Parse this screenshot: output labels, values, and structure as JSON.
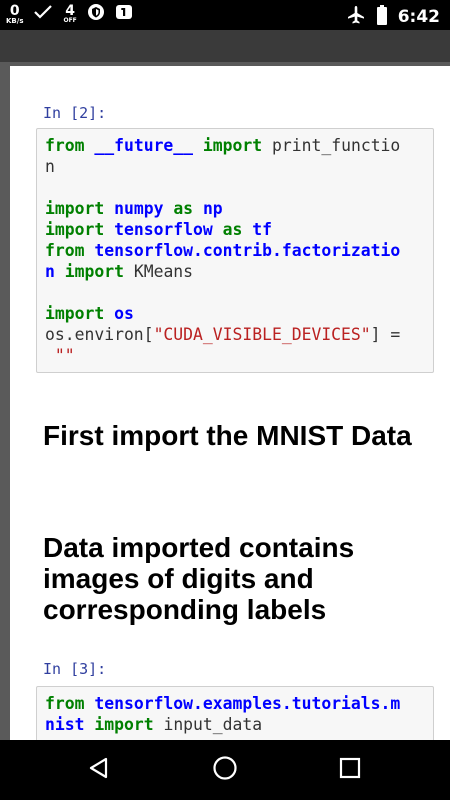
{
  "status_bar": {
    "net_speed_value": "0",
    "net_speed_unit": "KB/s",
    "network_type": "4",
    "network_sub": "OFF",
    "time": "6:42",
    "icons": [
      "check-icon",
      "vpn-shield-icon",
      "notification-badge-icon",
      "airplane-mode-icon",
      "battery-icon"
    ]
  },
  "notebook": {
    "cells": [
      {
        "prompt": "In [2]:",
        "lines": [
          [
            [
              "kw",
              "from"
            ],
            [
              "t",
              " "
            ],
            [
              "nm",
              "__future__"
            ],
            [
              "t",
              " "
            ],
            [
              "kw",
              "import"
            ],
            [
              "t",
              " print_functio"
            ]
          ],
          [
            [
              "t",
              "n"
            ]
          ],
          [
            [
              "t",
              ""
            ]
          ],
          [
            [
              "kw",
              "import"
            ],
            [
              "t",
              " "
            ],
            [
              "nm",
              "numpy"
            ],
            [
              "t",
              " "
            ],
            [
              "kw",
              "as"
            ],
            [
              "t",
              " "
            ],
            [
              "nm",
              "np"
            ]
          ],
          [
            [
              "kw",
              "import"
            ],
            [
              "t",
              " "
            ],
            [
              "nm",
              "tensorflow"
            ],
            [
              "t",
              " "
            ],
            [
              "kw",
              "as"
            ],
            [
              "t",
              " "
            ],
            [
              "nm",
              "tf"
            ]
          ],
          [
            [
              "kw",
              "from"
            ],
            [
              "t",
              " "
            ],
            [
              "nm",
              "tensorflow.contrib.factorizatio"
            ]
          ],
          [
            [
              "nm",
              "n"
            ],
            [
              "t",
              " "
            ],
            [
              "kw",
              "import"
            ],
            [
              "t",
              " KMeans"
            ]
          ],
          [
            [
              "t",
              ""
            ]
          ],
          [
            [
              "kw",
              "import"
            ],
            [
              "t",
              " "
            ],
            [
              "nm",
              "os"
            ]
          ],
          [
            [
              "t",
              "os.environ["
            ],
            [
              "st",
              "\"CUDA_VISIBLE_DEVICES\""
            ],
            [
              "t",
              "] ="
            ]
          ],
          [
            [
              "t",
              " "
            ],
            [
              "st",
              "\"\""
            ]
          ]
        ]
      },
      {
        "prompt": "In [3]:",
        "lines": [
          [
            [
              "kw",
              "from"
            ],
            [
              "t",
              " "
            ],
            [
              "nm",
              "tensorflow.examples.tutorials.m"
            ]
          ],
          [
            [
              "nm",
              "nist"
            ],
            [
              "t",
              " "
            ],
            [
              "kw",
              "import"
            ],
            [
              "t",
              " input_data"
            ]
          ]
        ]
      }
    ],
    "heading1": "First import the MNIST Data",
    "heading2": "Data imported contains images of digits and corresponding labels"
  },
  "nav_bar": {
    "back": "back-icon",
    "home": "home-icon",
    "recents": "recents-icon"
  },
  "colors": {
    "keyword": "#008000",
    "name": "#0000ff",
    "string": "#ba2121",
    "prompt": "#303f9f"
  }
}
